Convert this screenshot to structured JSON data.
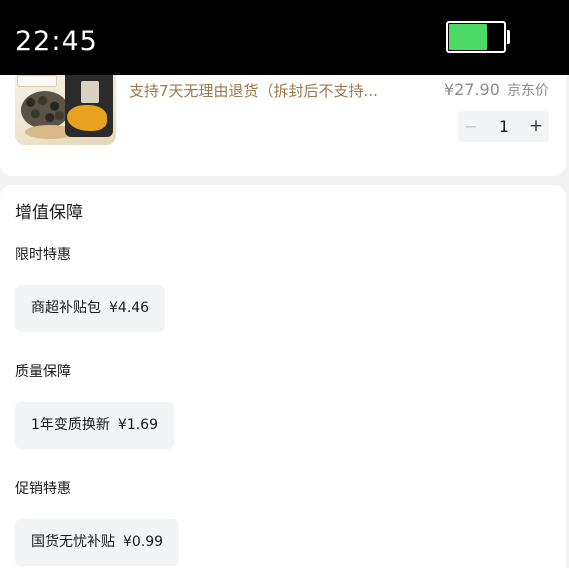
{
  "status_bar": {
    "time": "22:45",
    "battery_level": 0.68,
    "battery_color": "#4cd964"
  },
  "product": {
    "service_note": "支持7天无理由退货（拆封后不支持...",
    "price": "¥27.90",
    "price_label": "京东价",
    "quantity": "1",
    "minus_symbol": "−",
    "plus_symbol": "+"
  },
  "protection": {
    "title": "增值保障",
    "groups": [
      {
        "label": "限时特惠",
        "option": "商超补贴包",
        "price": "¥4.46"
      },
      {
        "label": "质量保障",
        "option": "1年变质换新",
        "price": "¥1.69"
      },
      {
        "label": "促销特惠",
        "option": "国货无忧补贴",
        "price": "¥0.99"
      }
    ]
  },
  "colors": {
    "note_text": "#9a7a4a",
    "chip_background": "#f3f4f6",
    "page_background": "#f2f2f2"
  }
}
